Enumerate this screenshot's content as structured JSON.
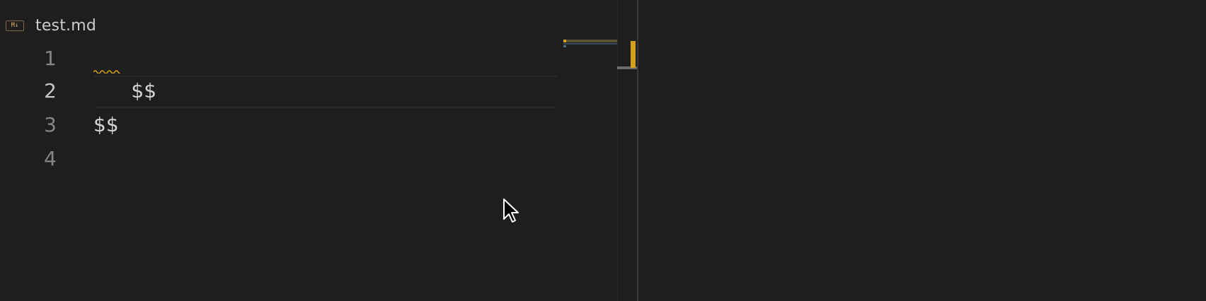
{
  "tab": {
    "icon": "markdown-icon",
    "icon_label": "M↓",
    "file_name": "test.md"
  },
  "editor": {
    "lines": [
      {
        "number": "1",
        "text": "$$",
        "has_warning": true
      },
      {
        "number": "2",
        "text": "",
        "is_current": true
      },
      {
        "number": "3",
        "text": "$$"
      },
      {
        "number": "4",
        "text": ""
      }
    ]
  },
  "colors": {
    "background": "#1e1e1e",
    "warning": "#d4a017",
    "line_number": "#858585",
    "text": "#d4d4d4"
  }
}
